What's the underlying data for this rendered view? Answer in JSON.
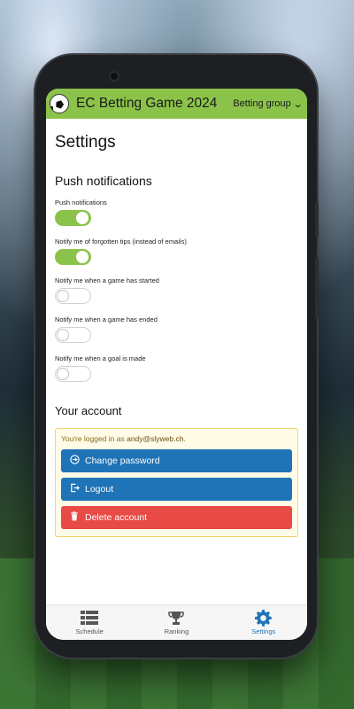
{
  "app": {
    "title": "EC Betting Game 2024",
    "group_label": "Betting group",
    "accent_color": "#8bc34a"
  },
  "page": {
    "title": "Settings"
  },
  "push": {
    "section_title": "Push notifications",
    "settings": [
      {
        "label": "Push notifications",
        "enabled": true
      },
      {
        "label": "Notify me of forgotten tips (instead of emails)",
        "enabled": true
      },
      {
        "label": "Notify me when a game has started",
        "enabled": false
      },
      {
        "label": "Notify me when a game has ended",
        "enabled": false
      },
      {
        "label": "Notify me when a goal is made",
        "enabled": false
      }
    ]
  },
  "account": {
    "section_title": "Your account",
    "logged_in_prefix": "You're logged in as ",
    "username": "andy@slyweb.ch",
    "logged_in_suffix": ".",
    "change_password_label": "Change password",
    "logout_label": "Logout",
    "delete_label": "Delete account"
  },
  "nav": {
    "items": [
      {
        "label": "Schedule",
        "icon": "list-icon",
        "active": false
      },
      {
        "label": "Ranking",
        "icon": "trophy-icon",
        "active": false
      },
      {
        "label": "Settings",
        "icon": "gear-icon",
        "active": true
      }
    ]
  }
}
